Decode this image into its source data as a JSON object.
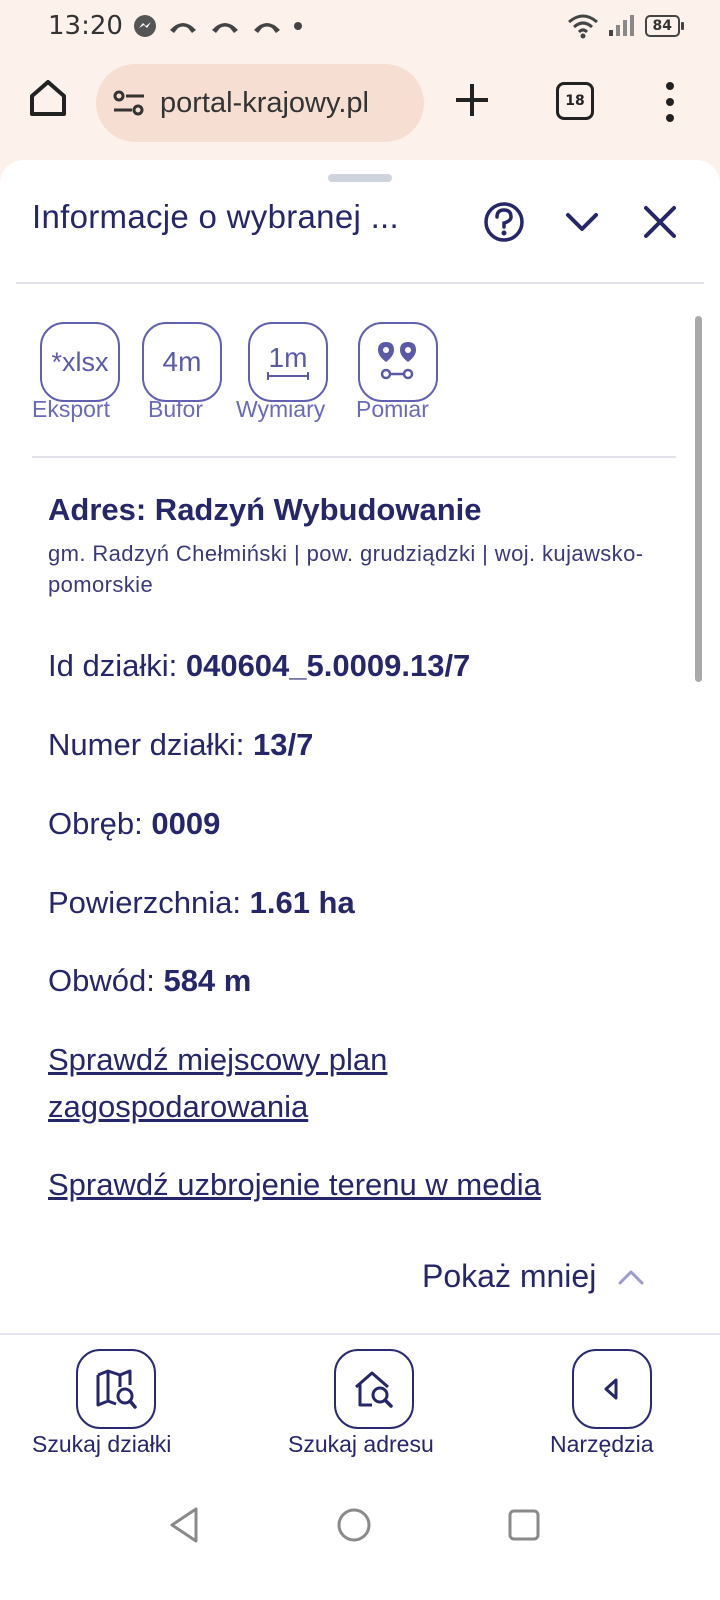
{
  "status_bar": {
    "time": "13:20",
    "battery": "84"
  },
  "browser": {
    "url": "portal-krajowy.pl",
    "tab_count": "18"
  },
  "panel": {
    "title": "Informacje o wybranej ...",
    "tools": [
      {
        "icon_text": "*xlsx",
        "label": "Eksport"
      },
      {
        "icon_text": "4m",
        "label": "Bufor"
      },
      {
        "icon_text": "1m",
        "label": "Wymiary"
      },
      {
        "icon_text": "",
        "label": "Pomiar"
      }
    ],
    "address_title": "Adres: Radzyń Wybudowanie",
    "address_sub": "gm. Radzyń Chełmiński | pow. grudziądzki | woj. kujawsko-pomorskie",
    "fields": [
      {
        "label": "Id działki: ",
        "value": "040604_5.0009.13/7"
      },
      {
        "label": "Numer działki: ",
        "value": "13/7"
      },
      {
        "label": "Obręb: ",
        "value": "0009"
      },
      {
        "label": "Powierzchnia: ",
        "value": "1.61 ha"
      },
      {
        "label": "Obwód: ",
        "value": "584 m"
      }
    ],
    "links": [
      "Sprawdź miejscowy plan zagospodarowania",
      "Sprawdź uzbrojenie terenu w media"
    ],
    "show_less": "Pokaż mniej"
  },
  "bottom_nav": [
    {
      "label": "Szukaj działki"
    },
    {
      "label": "Szukaj adresu"
    },
    {
      "label": "Narzędzia"
    }
  ],
  "colors": {
    "primary": "#26266a",
    "accent": "#6260b0"
  }
}
